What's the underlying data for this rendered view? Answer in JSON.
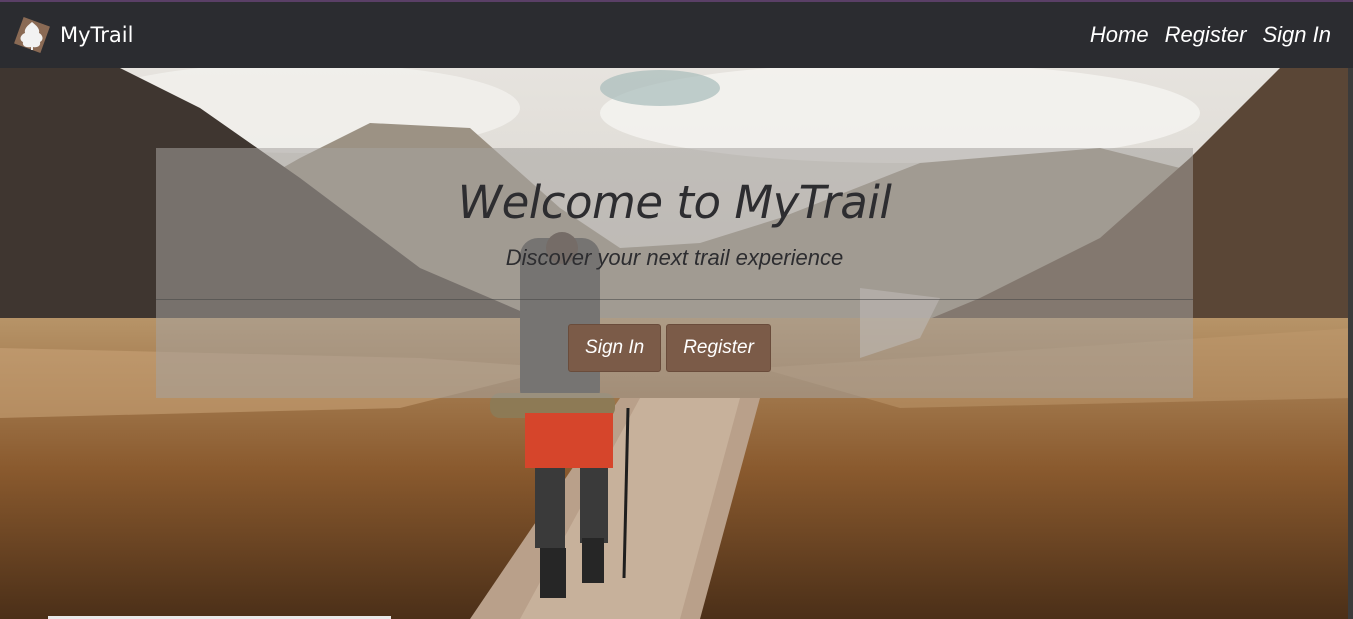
{
  "navbar": {
    "brand": "MyTrail",
    "logo_icon": "tree-icon",
    "links": [
      {
        "label": "Home"
      },
      {
        "label": "Register"
      },
      {
        "label": "Sign In"
      }
    ]
  },
  "hero": {
    "title": "Welcome to MyTrail",
    "subtitle": "Discover your next trail experience",
    "buttons": [
      {
        "label": "Sign In"
      },
      {
        "label": "Register"
      }
    ]
  },
  "colors": {
    "navbar_bg": "#2b2c30",
    "button_bg": "#7b5b48",
    "logo_bg": "#8a6a54"
  }
}
